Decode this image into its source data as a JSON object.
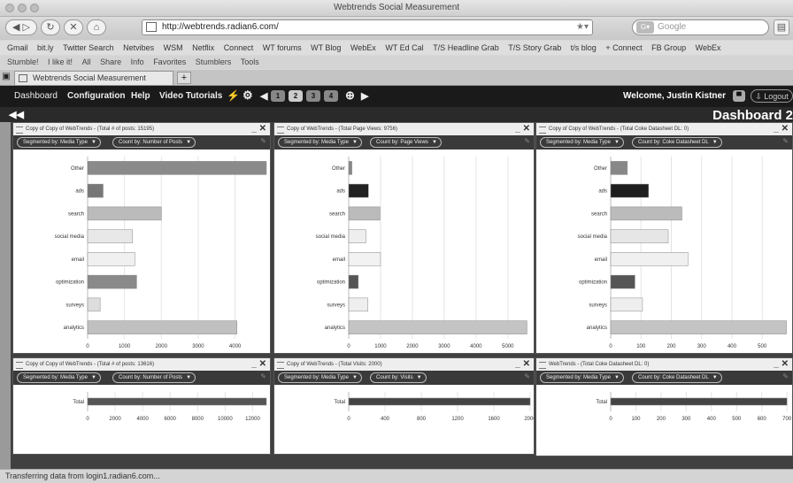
{
  "browser": {
    "title": "Webtrends Social Measurement",
    "url": "http://webtrends.radian6.com/",
    "search_placeholder": "Google",
    "bookmarks": [
      "Gmail",
      "bit.ly",
      "Twitter Search",
      "Netvibes",
      "WSM",
      "Netflix",
      "Connect",
      "WT forums",
      "WT Blog",
      "WebEx",
      "WT Ed Cal",
      "T/S Headline Grab",
      "T/S Story Grab",
      "t/s blog",
      "+ Connect",
      "FB Group",
      "WebEx"
    ],
    "toolbar2": [
      "Stumble!",
      "I like it!",
      "All",
      "Share",
      "Info",
      "Favorites",
      "Stumblers",
      "Tools"
    ],
    "tab_title": "Webtrends Social Measurement",
    "status": "Transferring data from login1.radian6.com..."
  },
  "app": {
    "menu": [
      "Dashboard",
      "Configuration",
      "Help",
      "Video Tutorials"
    ],
    "pages": [
      "1",
      "2",
      "3",
      "4"
    ],
    "welcome": "Welcome, Justin Kistner",
    "logout": "Logout",
    "dashboard_title": "Dashboard 2"
  },
  "colors": {
    "dark_bar": "#222222",
    "mid_bar": "#9a9a9a",
    "light_bar": "#e6e6e6"
  },
  "widgets": [
    {
      "title": "Copy of Copy of WebTrends - (Total # of posts: 15195)",
      "segment": "Segmented by: Media Type",
      "count": "Count by: Number of Posts",
      "chart_data": {
        "type": "bar",
        "orientation": "horizontal",
        "categories": [
          "Other",
          "ads",
          "search",
          "social media",
          "email",
          "optimization",
          "surveys",
          "analytics"
        ],
        "values": [
          4850,
          420,
          2000,
          1220,
          1280,
          1330,
          340,
          4050
        ],
        "xlim": [
          0,
          4850
        ],
        "ticks": [
          0,
          1000,
          2000,
          3000,
          4000
        ],
        "shades": [
          "#8a8a8a",
          "#777777",
          "#bbbbbb",
          "#e8e8e8",
          "#f0f0f0",
          "#8a8a8a",
          "#dddddd",
          "#c0c0c0"
        ]
      }
    },
    {
      "title": "Copy of WebTrends - (Total Page Views: 9756)",
      "segment": "Segmented by: Media Type",
      "count": "Count by: Page Views",
      "chart_data": {
        "type": "bar",
        "orientation": "horizontal",
        "categories": [
          "Other",
          "ads",
          "search",
          "social media",
          "email",
          "optimization",
          "surveys",
          "analytics"
        ],
        "values": [
          100,
          620,
          980,
          540,
          1000,
          300,
          600,
          5600
        ],
        "xlim": [
          0,
          5700
        ],
        "ticks": [
          0,
          1000,
          2000,
          3000,
          4000,
          5000
        ],
        "shades": [
          "#888888",
          "#222222",
          "#bbbbbb",
          "#eeeeee",
          "#f2f2f2",
          "#555555",
          "#eeeeee",
          "#c4c4c4"
        ]
      }
    },
    {
      "title": "Copy of Copy of WebTrends - (Total Coke Datasheet DL: 0)",
      "segment": "Segmented by: Media Type",
      "count": "Count by: Coke Datasheet DL",
      "chart_data": {
        "type": "bar",
        "orientation": "horizontal",
        "categories": [
          "Other",
          "ads",
          "search",
          "social media",
          "email",
          "optimization",
          "surveys",
          "analytics"
        ],
        "values": [
          55,
          125,
          235,
          190,
          255,
          80,
          105,
          580
        ],
        "xlim": [
          0,
          590
        ],
        "ticks": [
          0,
          100,
          200,
          300,
          400,
          500
        ],
        "shades": [
          "#888888",
          "#1e1e1e",
          "#bbbbbb",
          "#e6e6e6",
          "#f0f0f0",
          "#555555",
          "#eeeeee",
          "#c4c4c4"
        ]
      }
    },
    {
      "title": "Copy of Copy of WebTrends - (Total # of posts: 13616)",
      "segment": "Segmented by: Media Type",
      "count": "Count by: Number of Posts",
      "chart_data": {
        "type": "bar",
        "orientation": "horizontal",
        "categories": [
          "Total"
        ],
        "values": [
          13616
        ],
        "xlim": [
          0,
          13000
        ],
        "ticks": [
          0,
          2000,
          4000,
          6000,
          8000,
          10000,
          12000
        ],
        "shades": [
          "#555555"
        ]
      }
    },
    {
      "title": "Copy of WebTrends - (Total Visits: 2000)",
      "segment": "Segmented by: Media Type",
      "count": "Count by: Visits",
      "chart_data": {
        "type": "bar",
        "orientation": "horizontal",
        "categories": [
          "Total"
        ],
        "values": [
          2000
        ],
        "xlim": [
          0,
          2000
        ],
        "ticks": [
          0,
          400,
          800,
          1200,
          1600,
          2000
        ],
        "shades": [
          "#444444"
        ]
      }
    },
    {
      "title": "WebTrends - (Total Coke Datasheet DL: 0)",
      "segment": "Segmented by: Media Type",
      "count": "Count by: Coke Datasheet DL",
      "chart_data": {
        "type": "bar",
        "orientation": "horizontal",
        "categories": [
          "Total"
        ],
        "values": [
          700
        ],
        "xlim": [
          0,
          710
        ],
        "ticks": [
          0,
          100,
          200,
          300,
          400,
          500,
          600,
          700
        ],
        "shades": [
          "#444444"
        ]
      }
    }
  ]
}
